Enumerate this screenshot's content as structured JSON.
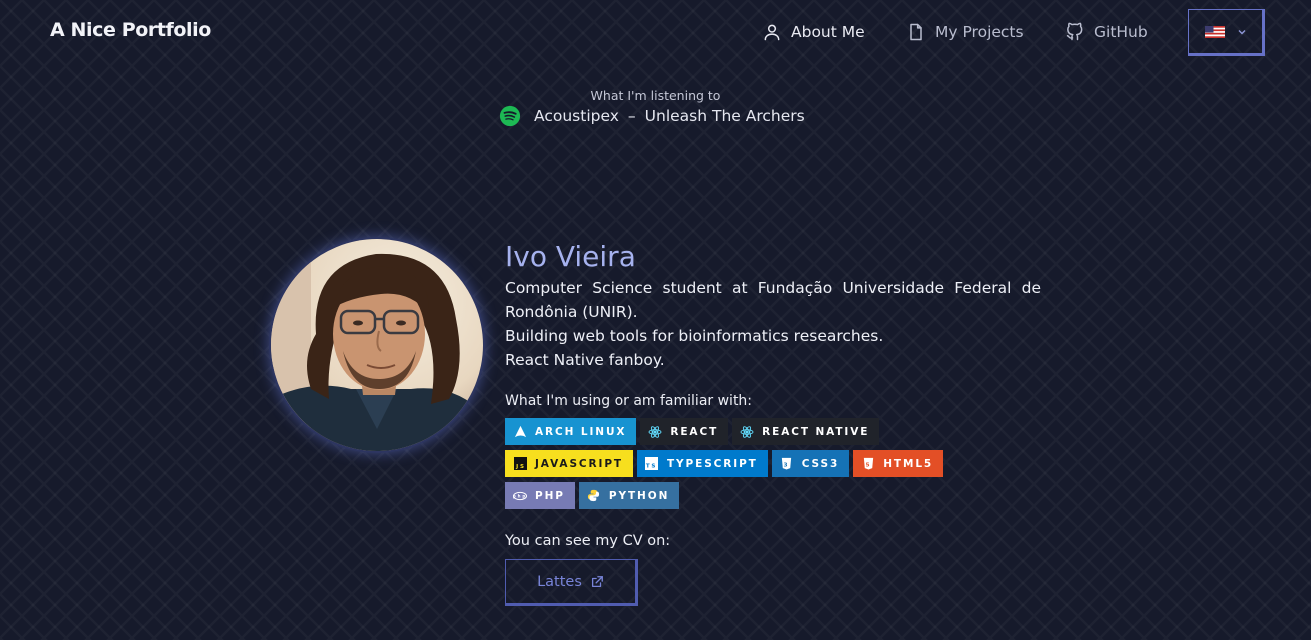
{
  "nav": {
    "brand": "A Nice Portfolio",
    "links": [
      {
        "label": "About Me",
        "icon": "user-icon"
      },
      {
        "label": "My Projects",
        "icon": "file-icon"
      },
      {
        "label": "GitHub",
        "icon": "github-icon"
      }
    ],
    "language_flag": "flag-us-icon"
  },
  "listening": {
    "label": "What I'm listening to",
    "artist": "Acoustipex",
    "separator": "–",
    "track": "Unleash The Archers",
    "icon": "spotify-icon"
  },
  "profile": {
    "name": "Ivo Vieira",
    "bio": [
      "Computer Science student at Fundação Universidade Federal de Rondônia (UNIR).",
      "Building web tools for bioinformatics researches.",
      "React Native fanboy."
    ],
    "skills_title": "What I'm using or am familiar with:",
    "skills": [
      {
        "label": "ARCH LINUX",
        "color": "#1793d1",
        "icon": "arch-icon"
      },
      {
        "label": "REACT",
        "color": "#20232a",
        "icon": "react-icon"
      },
      {
        "label": "REACT NATIVE",
        "color": "#20232a",
        "icon": "react-icon"
      },
      {
        "label": "JAVASCRIPT",
        "color": "#f7df1e",
        "icon": "javascript-icon"
      },
      {
        "label": "TYPESCRIPT",
        "color": "#007acc",
        "icon": "typescript-icon"
      },
      {
        "label": "CSS3",
        "color": "#1572b6",
        "icon": "css3-icon"
      },
      {
        "label": "HTML5",
        "color": "#e34f26",
        "icon": "html5-icon"
      },
      {
        "label": "PHP",
        "color": "#777bb4",
        "icon": "php-icon"
      },
      {
        "label": "PYTHON",
        "color": "#3670a0",
        "icon": "python-icon"
      }
    ],
    "cv_title": "You can see my CV on:",
    "cv_button": "Lattes"
  },
  "colors": {
    "background": "#161a2b",
    "accent": "#6671c7",
    "name": "#a6b2ee",
    "spotify": "#1db954"
  }
}
